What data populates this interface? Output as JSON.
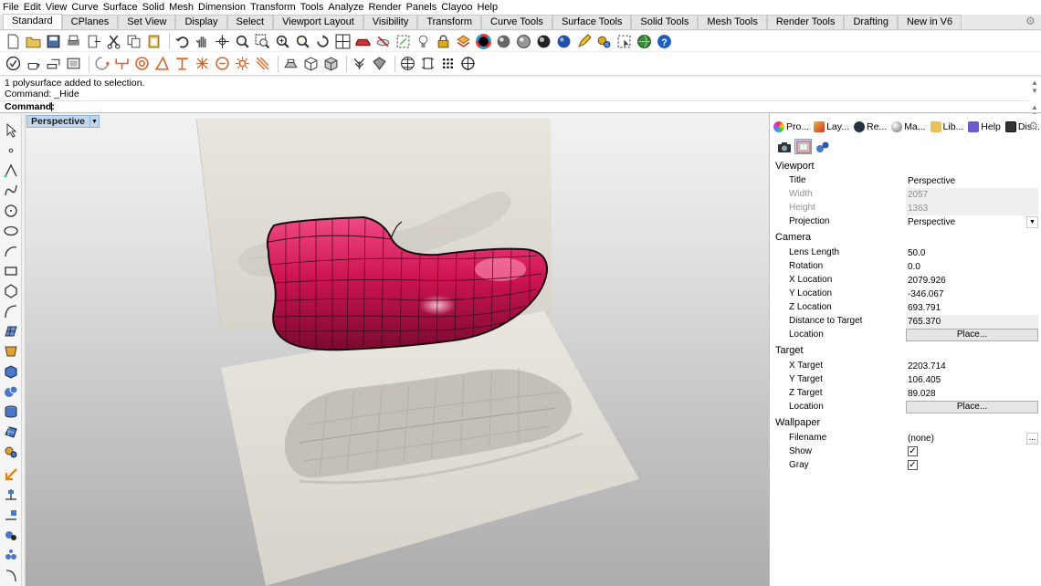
{
  "menu": [
    "File",
    "Edit",
    "View",
    "Curve",
    "Surface",
    "Solid",
    "Mesh",
    "Dimension",
    "Transform",
    "Tools",
    "Analyze",
    "Render",
    "Panels",
    "Clayoo",
    "Help"
  ],
  "tabs": [
    "Standard",
    "CPlanes",
    "Set View",
    "Display",
    "Select",
    "Viewport Layout",
    "Visibility",
    "Transform",
    "Curve Tools",
    "Surface Tools",
    "Solid Tools",
    "Mesh Tools",
    "Render Tools",
    "Drafting",
    "New in V6"
  ],
  "active_tab": "Standard",
  "command": {
    "history": [
      "1 polysurface added to selection.",
      "Command: _Hide"
    ],
    "prompt": "Command:"
  },
  "viewport": {
    "title": "Perspective"
  },
  "panel": {
    "tabs": [
      "Pro...",
      "Lay...",
      "Re...",
      "Ma...",
      "Lib...",
      "Help",
      "Dis..."
    ],
    "sections": {
      "viewport": {
        "heading": "Viewport",
        "title_label": "Title",
        "title_value": "Perspective",
        "width_label": "Width",
        "width_value": "2057",
        "height_label": "Height",
        "height_value": "1363",
        "projection_label": "Projection",
        "projection_value": "Perspective"
      },
      "camera": {
        "heading": "Camera",
        "lens_label": "Lens Length",
        "lens_value": "50.0",
        "rotation_label": "Rotation",
        "rotation_value": "0.0",
        "x_label": "X Location",
        "x_value": "2079.926",
        "y_label": "Y Location",
        "y_value": "-346.067",
        "z_label": "Z Location",
        "z_value": "693.791",
        "dist_label": "Distance to Target",
        "dist_value": "765.370",
        "location_label": "Location",
        "place_label": "Place..."
      },
      "target": {
        "heading": "Target",
        "x_label": "X Target",
        "x_value": "2203.714",
        "y_label": "Y Target",
        "y_value": "106.405",
        "z_label": "Z Target",
        "z_value": "89.028",
        "location_label": "Location",
        "place_label": "Place..."
      },
      "wallpaper": {
        "heading": "Wallpaper",
        "filename_label": "Filename",
        "filename_value": "(none)",
        "show_label": "Show",
        "show_checked": true,
        "gray_label": "Gray",
        "gray_checked": true
      }
    }
  },
  "colors": {
    "shoe": "#d81a5a",
    "tab_active": "#ffffff",
    "viewport_title": "#c2d7ea"
  }
}
